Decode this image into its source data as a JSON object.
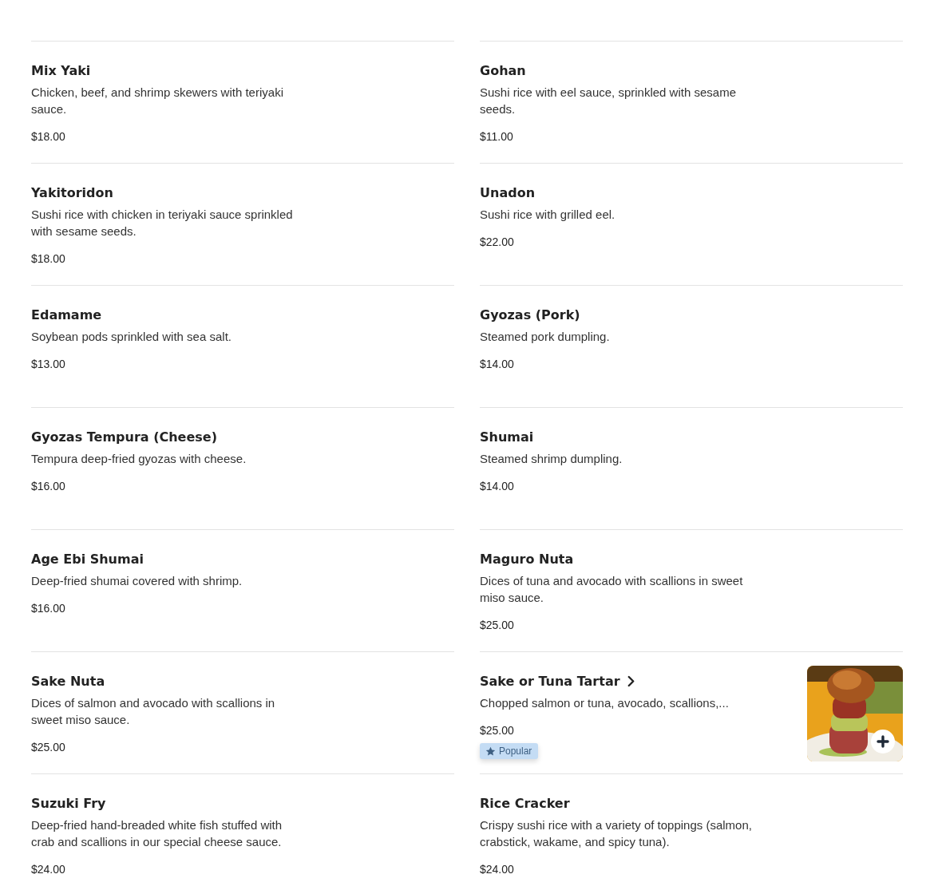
{
  "menu_items": [
    {
      "name": "Mix Yaki",
      "description": "Chicken, beef, and shrimp skewers with teriyaki sauce.",
      "price": "$18.00"
    },
    {
      "name": "Gohan",
      "description": "Sushi rice with eel sauce, sprinkled with sesame seeds.",
      "price": "$11.00"
    },
    {
      "name": "Yakitoridon",
      "description": "Sushi rice with chicken in teriyaki sauce sprinkled with sesame seeds.",
      "price": "$18.00"
    },
    {
      "name": "Unadon",
      "description": "Sushi rice with grilled eel.",
      "price": "$22.00"
    },
    {
      "name": "Edamame",
      "description": "Soybean pods sprinkled with sea salt.",
      "price": "$13.00"
    },
    {
      "name": "Gyozas (Pork)",
      "description": "Steamed pork dumpling.",
      "price": "$14.00"
    },
    {
      "name": "Gyozas Tempura (Cheese)",
      "description": "Tempura deep-fried gyozas with cheese.",
      "price": "$16.00"
    },
    {
      "name": "Shumai",
      "description": "Steamed shrimp dumpling.",
      "price": "$14.00"
    },
    {
      "name": "Age Ebi Shumai",
      "description": "Deep-fried shumai covered with shrimp.",
      "price": "$16.00"
    },
    {
      "name": "Maguro Nuta",
      "description": "Dices of tuna and avocado with scallions in sweet miso sauce.",
      "price": "$25.00"
    },
    {
      "name": "Sake Nuta",
      "description": "Dices of salmon and avocado with scallions in sweet miso sauce.",
      "price": "$25.00"
    },
    {
      "name": "Sake or Tuna Tartar",
      "has_details": true,
      "description": "Chopped salmon or tuna, avocado, scallions,...",
      "price": "$25.00",
      "badge": "Popular"
    },
    {
      "name": "Suzuki Fry",
      "description": "Deep-fried hand-breaded white fish stuffed with crab and scallions in our special cheese sauce.",
      "price": "$24.00"
    },
    {
      "name": "Rice Cracker",
      "description": "Crispy sushi rice with a variety of toppings (salmon, crabstick, wakame, and spicy tuna).",
      "price": "$24.00"
    }
  ]
}
